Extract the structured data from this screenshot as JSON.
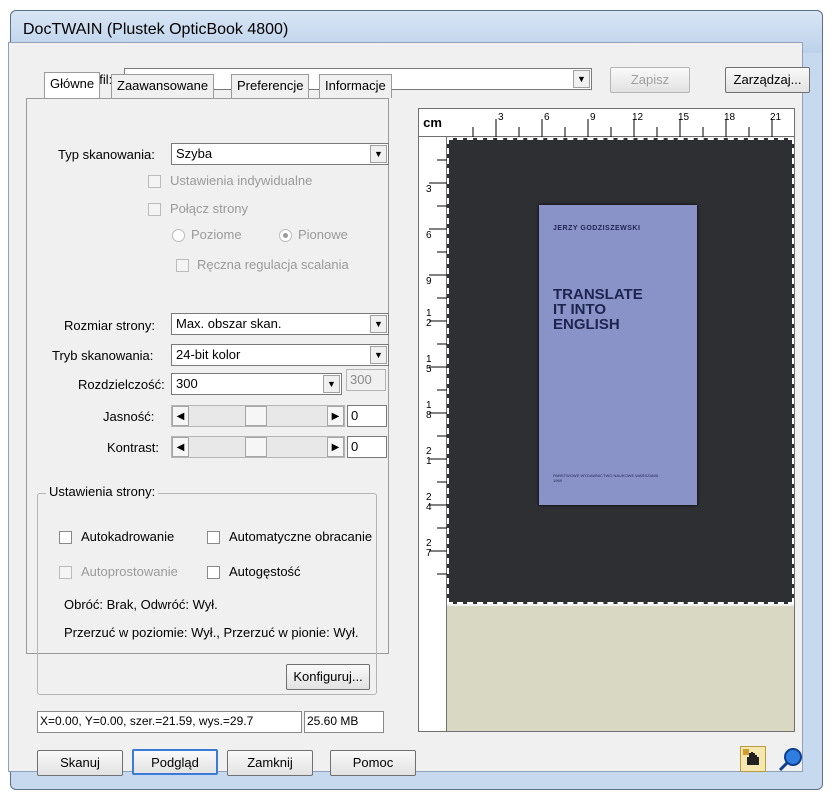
{
  "window": {
    "title": "DocTWAIN (Plustek OpticBook 4800)"
  },
  "profile": {
    "label": "Profil:",
    "value": "",
    "save_button": "Zapisz",
    "manage_button": "Zarządzaj..."
  },
  "tabs": [
    {
      "label": "Główne",
      "active": true
    },
    {
      "label": "Zaawansowane",
      "active": false
    },
    {
      "label": "Preferencje",
      "active": false
    },
    {
      "label": "Informacje",
      "active": false
    }
  ],
  "main": {
    "scan_type": {
      "label": "Typ skanowania:",
      "value": "Szyba"
    },
    "individual_settings": "Ustawienia indywidualne",
    "merge_pages": "Połącz strony",
    "horizontal": "Poziome",
    "vertical": "Pionowe",
    "manual_merge": "Ręczna regulacja scalania",
    "page_size": {
      "label": "Rozmiar strony:",
      "value": "Max. obszar skan."
    },
    "scan_mode": {
      "label": "Tryb skanowania:",
      "value": "24-bit kolor"
    },
    "resolution": {
      "label": "Rozdzielczość:",
      "value": "300",
      "readout": "300"
    },
    "brightness": {
      "label": "Jasność:",
      "value": "0"
    },
    "contrast": {
      "label": "Kontrast:",
      "value": "0"
    }
  },
  "page_settings": {
    "title": "Ustawienia strony:",
    "autocrop": "Autokadrowanie",
    "autorotate": "Automatyczne obracanie",
    "autodeskew": "Autoprostowanie",
    "autodensity": "Autogęstość",
    "rotate_info": "Obróć: Brak, Odwróć: Wył.",
    "flip_info": "Przerzuć w poziomie: Wył., Przerzuć w pionie: Wył.",
    "configure_button": "Konfiguruj..."
  },
  "status": {
    "coords": "X=0.00, Y=0.00, szer.=21.59, wys.=29.7",
    "size": "25.60 MB"
  },
  "buttons": {
    "scan": "Skanuj",
    "preview": "Podgląd",
    "close": "Zamknij",
    "help": "Pomoc"
  },
  "ruler": {
    "corner": "cm",
    "h_ticks": [
      "3",
      "6",
      "9",
      "12",
      "15",
      "18",
      "21"
    ],
    "v_ticks": [
      "3",
      "6",
      "9",
      "12",
      "15",
      "18",
      "21",
      "24",
      "27"
    ]
  },
  "preview_book": {
    "author": "JERZY GODZISZEWSKI",
    "title_lines": [
      "TRANSLATE",
      "IT INTO",
      "ENGLISH"
    ],
    "publisher": "PAŃSTWOWE WYDAWNICTWO NAUKOWE WARSZAWA 1969"
  },
  "colors": {
    "window_frame": "#c7d9ee",
    "book_cover": "#8a93c8",
    "scan_bg": "#2e2f33"
  }
}
